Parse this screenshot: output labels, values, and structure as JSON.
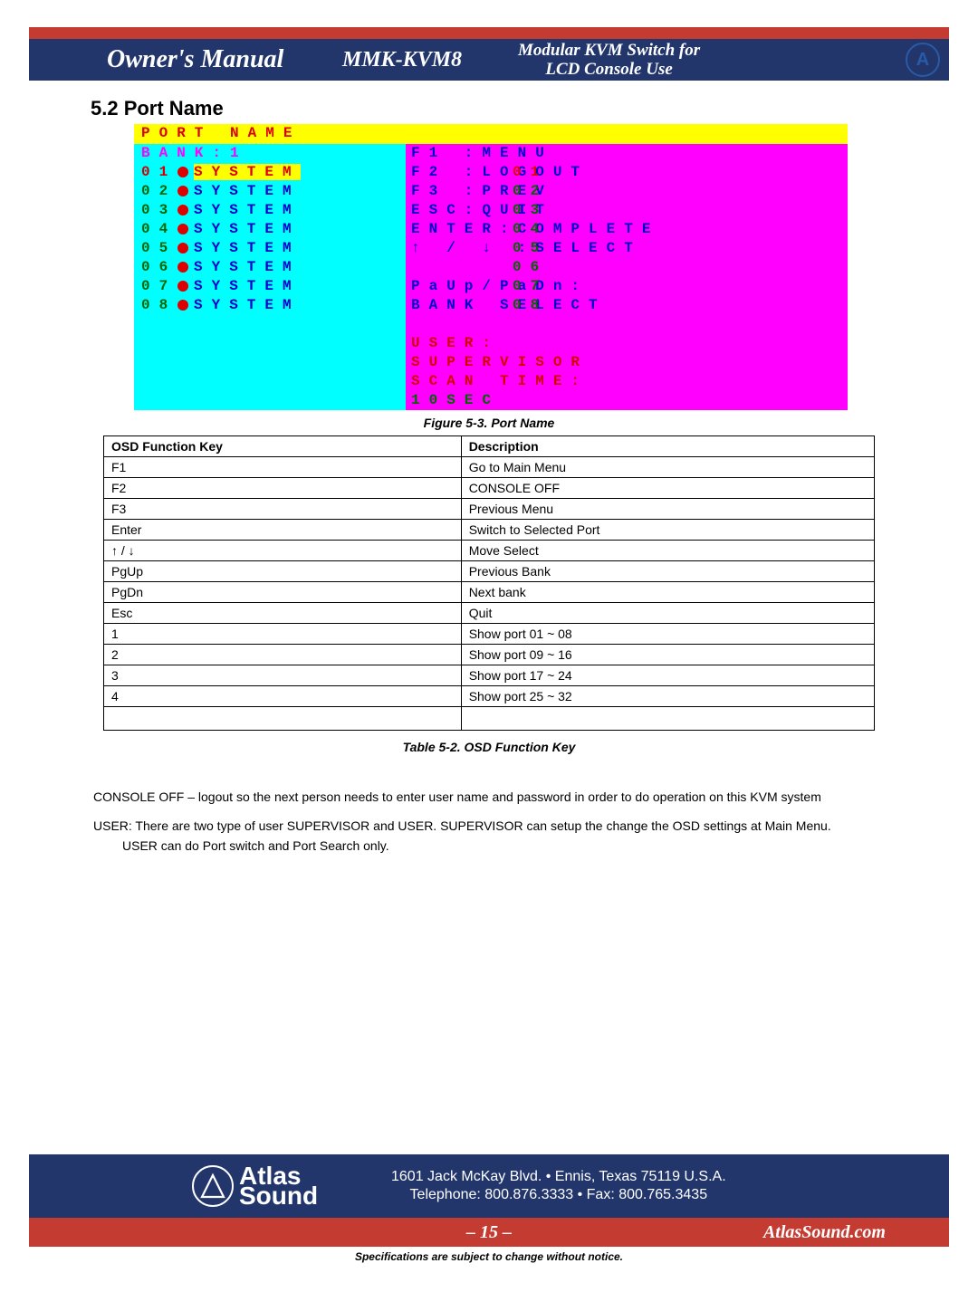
{
  "header": {
    "owners": "Owner's Manual",
    "model": "MMK-KVM8",
    "tagline1": "Modular KVM Switch for",
    "tagline2": "LCD Console Use"
  },
  "section": {
    "num_title": "5.2  Port Name"
  },
  "osd": {
    "title": "PORT  NAME",
    "bank": "BANK:1",
    "rows": [
      {
        "idx": "01",
        "name": "SYSTEM",
        "num": "01",
        "sel": true
      },
      {
        "idx": "02",
        "name": "SYSTEM",
        "num": "02",
        "sel": false
      },
      {
        "idx": "03",
        "name": "SYSTEM",
        "num": "03",
        "sel": false
      },
      {
        "idx": "04",
        "name": "SYSTEM",
        "num": "04",
        "sel": false
      },
      {
        "idx": "05",
        "name": "SYSTEM",
        "num": "05",
        "sel": false
      },
      {
        "idx": "06",
        "name": "SYSTEM",
        "num": "06",
        "sel": false
      },
      {
        "idx": "07",
        "name": "SYSTEM",
        "num": "07",
        "sel": false
      },
      {
        "idx": "08",
        "name": "SYSTEM",
        "num": "08",
        "sel": false
      }
    ],
    "hints": [
      "F1 :MENU",
      "F2 :LOGOUT",
      "F3 :PREV",
      "ESC:QUIT",
      "ENTER:COMPLETE",
      "↑ / ↓ :SELECT",
      "",
      "PaUp/PaDn:",
      "BANK  SELECT",
      "",
      "USER:",
      "SUPERVISOR",
      "SCAN  TIME:",
      "10SEC"
    ]
  },
  "figcap": "Figure 5-3. Port Name",
  "table": {
    "h1": "OSD Function Key",
    "h2": "Description",
    "rows": [
      {
        "k": "F1",
        "d": "Go to Main Menu"
      },
      {
        "k": "F2",
        "d": "CONSOLE OFF"
      },
      {
        "k": "F3",
        "d": "Previous Menu"
      },
      {
        "k": "Enter",
        "d": "Switch to Selected Port"
      },
      {
        "k": "↑ / ↓",
        "d": "Move Select"
      },
      {
        "k": "PgUp",
        "d": "Previous Bank"
      },
      {
        "k": "PgDn",
        "d": "Next bank"
      },
      {
        "k": "Esc",
        "d": "Quit"
      },
      {
        "k": "1",
        "d": "Show port 01 ~ 08"
      },
      {
        "k": "2",
        "d": "Show port 09 ~ 16"
      },
      {
        "k": "3",
        "d": "Show port 17 ~ 24"
      },
      {
        "k": "4",
        "d": "Show port 25 ~ 32"
      }
    ]
  },
  "tblcap": "Table 5-2. OSD Function Key",
  "paras": {
    "p1": "CONSOLE OFF – logout so the next person needs to enter user name and password in order to do operation on this KVM system",
    "p2a": "USER: There are two type of user SUPERVISOR and USER. SUPERVISOR can setup the change the OSD settings at Main Menu.",
    "p2b": "USER can do Port switch and Port Search only."
  },
  "footer": {
    "brand": "Atlas\nSound",
    "addr1": "1601 Jack McKay Blvd. • Ennis, Texas 75119  U.S.A.",
    "addr2": "Telephone: 800.876.3333 • Fax: 800.765.3435",
    "page": "– 15 –",
    "url": "AtlasSound.com",
    "disc": "Specifications are subject to change without notice."
  }
}
